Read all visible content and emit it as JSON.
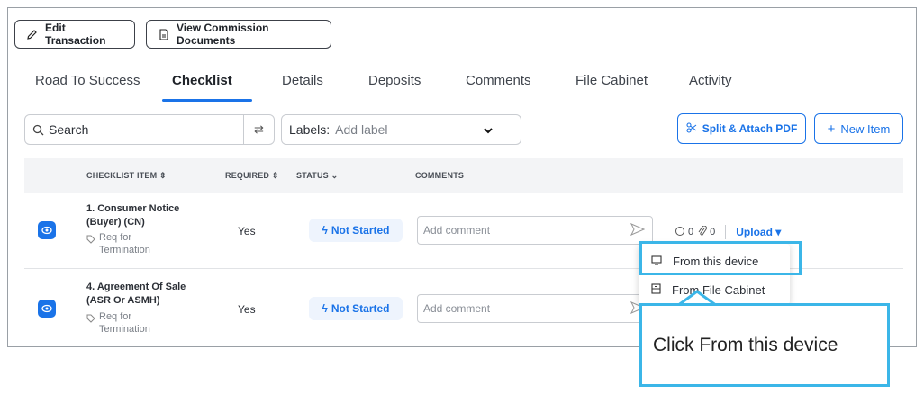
{
  "toolbar": {
    "edit_label": "Edit Transaction",
    "docs_label": "View Commission Documents"
  },
  "tabs": [
    {
      "label": "Road To Success"
    },
    {
      "label": "Checklist",
      "active": true
    },
    {
      "label": "Details"
    },
    {
      "label": "Deposits"
    },
    {
      "label": "Comments"
    },
    {
      "label": "File Cabinet"
    },
    {
      "label": "Activity"
    }
  ],
  "search": {
    "value": "Search"
  },
  "labels": {
    "label": "Labels:",
    "placeholder": "Add label"
  },
  "actions": {
    "split_label": "Split & Attach PDF",
    "new_label": "New Item"
  },
  "table": {
    "headers": {
      "item": "CHECKLIST ITEM",
      "required": "REQUIRED",
      "status": "STATUS",
      "comments": "COMMENTS"
    },
    "rows": [
      {
        "title_line1": "1. Consumer Notice",
        "title_line2": "(Buyer) (CN)",
        "tag_line1": "Req for",
        "tag_line2": "Termination",
        "required": "Yes",
        "status": "Not Started",
        "comment_placeholder": "Add comment",
        "comment_count": "0",
        "attach_count": "0",
        "upload_label": "Upload"
      },
      {
        "title_line1": "4. Agreement Of Sale",
        "title_line2": "(ASR Or ASMH)",
        "tag_line1": "Req for",
        "tag_line2": "Termination",
        "required": "Yes",
        "status": "Not Started",
        "comment_placeholder": "Add comment"
      }
    ]
  },
  "upload_menu": {
    "items": [
      {
        "label": "From this device"
      },
      {
        "label": "From File Cabinet"
      }
    ]
  },
  "callout": {
    "text": "Click From this device"
  },
  "colors": {
    "accent": "#1a73e8",
    "highlight": "#3bb6e8"
  }
}
